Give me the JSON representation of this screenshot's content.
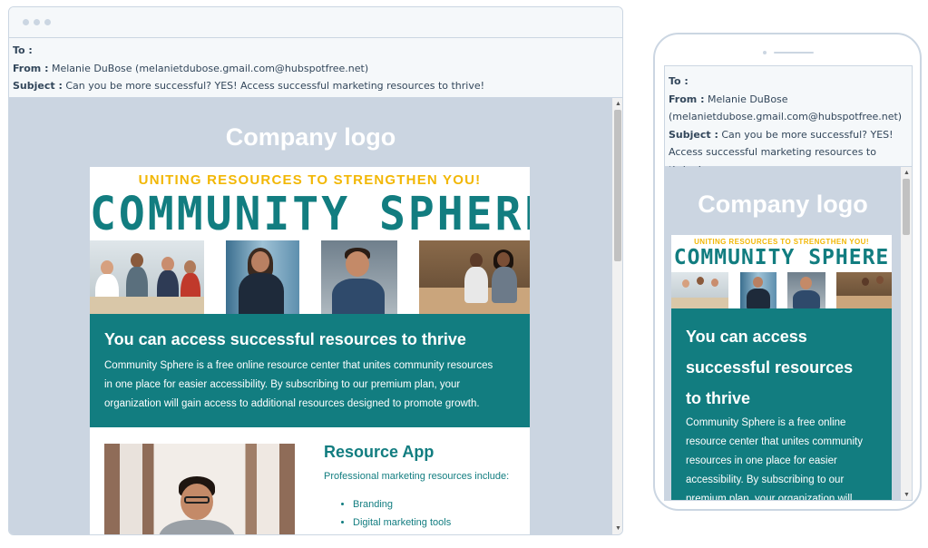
{
  "email": {
    "to_label": "To :",
    "from_label": "From :",
    "from_value": "Melanie DuBose (melanietdubose.gmail.com@hubspotfree.net)",
    "from_name": "Melanie DuBose",
    "from_address": "(melanietdubose.gmail.com@hubspotfree.net)",
    "subject_label": "Subject :",
    "subject_value": "Can you be more successful? YES! Access successful marketing resources to thrive!",
    "subject_line1": "Can you be more successful? YES!",
    "subject_line2": "Access successful marketing resources to thrive!"
  },
  "content": {
    "logo_text": "Company logo",
    "banner_tagline": "UNITING RESOURCES TO STRENGTHEN YOU!",
    "banner_title": "COMMUNITY SPHERE",
    "hero_heading": "You can access successful resources to thrive",
    "hero_heading_mobile": [
      "You can access",
      "successful resources",
      "to thrive"
    ],
    "hero_body": "Community Sphere is a free online resource center that unites community resources in one place for easier accessibility. By subscribing to our premium plan, your organization will gain access to additional resources designed to promote growth.",
    "hero_body_lines_desktop": [
      "Community Sphere is a free online resource center that unites community resources",
      "in one place for easier accessibility. By subscribing to our premium plan, your",
      "organization will gain access to additional resources designed to promote growth."
    ],
    "hero_body_lines_mobile": [
      "Community Sphere is a free online",
      "resource center that unites community",
      "resources in one place for easier",
      "accessibility. By subscribing to our",
      "premium plan, your organization will"
    ],
    "section_title": "Resource App",
    "section_subtitle": "Professional marketing resources include:",
    "section_items": [
      "Branding",
      "Digital marketing tools"
    ]
  },
  "colors": {
    "teal": "#127d80",
    "gold": "#f2b705",
    "canvas": "#cbd5e1",
    "text": "#33475b"
  }
}
